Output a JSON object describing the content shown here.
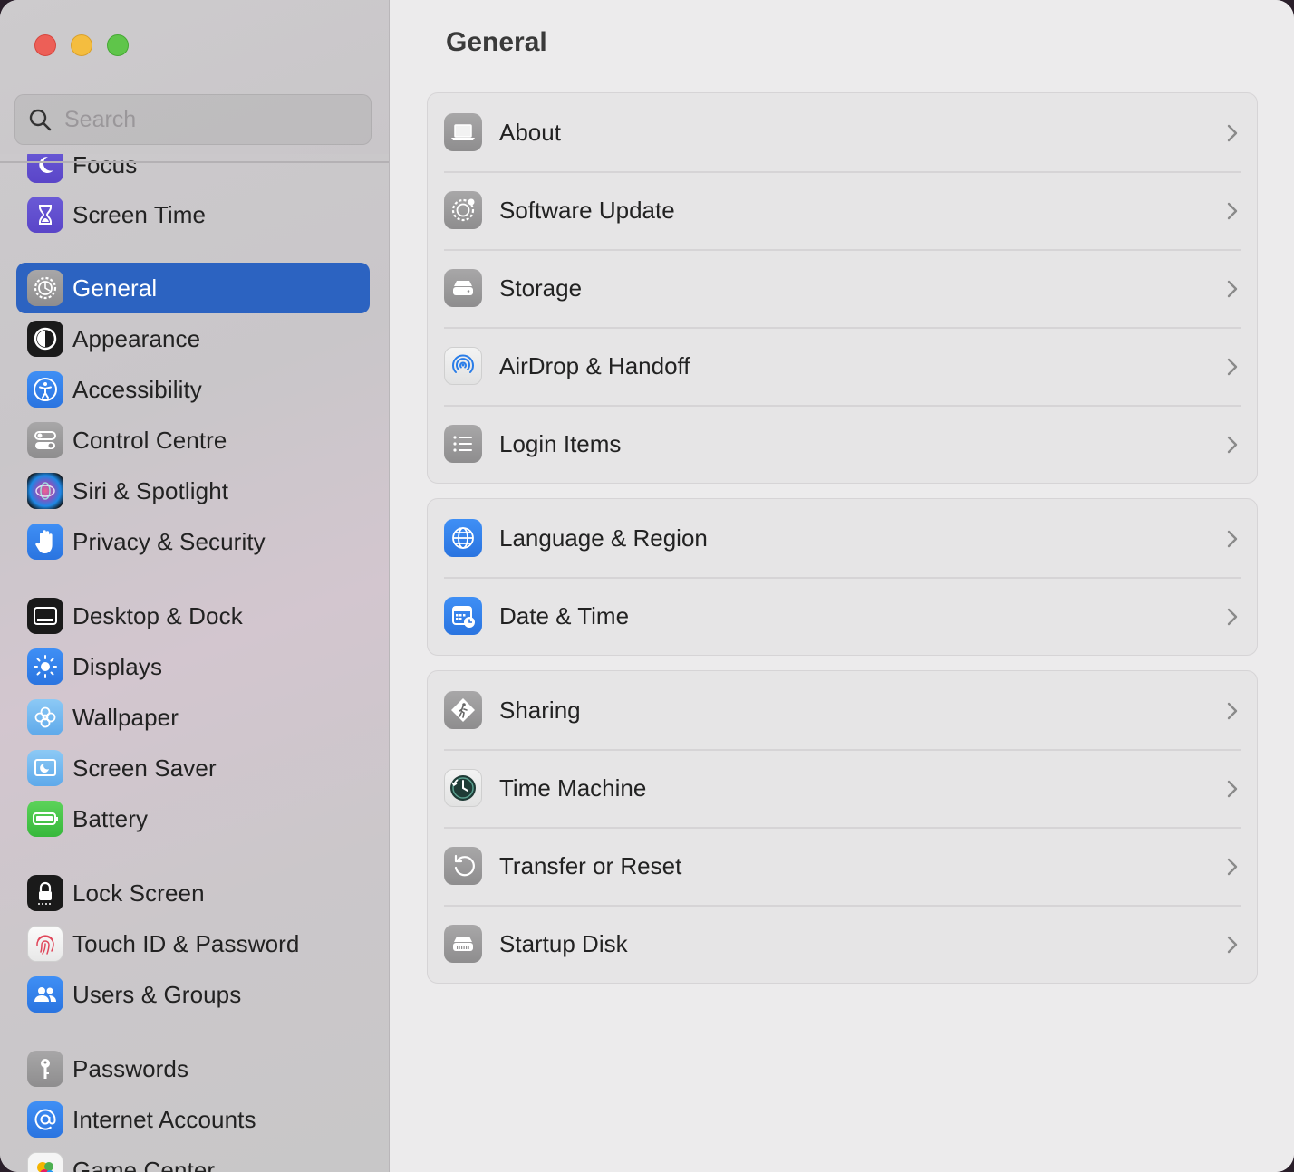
{
  "window": {
    "title": "General"
  },
  "search": {
    "placeholder": "Search"
  },
  "sidebar": {
    "items": [
      {
        "label": "Focus",
        "icon": "moon-icon"
      },
      {
        "label": "Screen Time",
        "icon": "hourglass-icon"
      },
      {
        "label": "General",
        "icon": "gear-icon",
        "selected": true
      },
      {
        "label": "Appearance",
        "icon": "appearance-icon"
      },
      {
        "label": "Accessibility",
        "icon": "accessibility-icon"
      },
      {
        "label": "Control Centre",
        "icon": "toggles-icon"
      },
      {
        "label": "Siri & Spotlight",
        "icon": "siri-icon"
      },
      {
        "label": "Privacy & Security",
        "icon": "hand-icon"
      },
      {
        "label": "Desktop & Dock",
        "icon": "dock-icon"
      },
      {
        "label": "Displays",
        "icon": "sun-icon"
      },
      {
        "label": "Wallpaper",
        "icon": "flower-icon"
      },
      {
        "label": "Screen Saver",
        "icon": "screensaver-icon"
      },
      {
        "label": "Battery",
        "icon": "battery-icon"
      },
      {
        "label": "Lock Screen",
        "icon": "lock-icon"
      },
      {
        "label": "Touch ID & Password",
        "icon": "fingerprint-icon"
      },
      {
        "label": "Users & Groups",
        "icon": "users-icon"
      },
      {
        "label": "Passwords",
        "icon": "key-icon"
      },
      {
        "label": "Internet Accounts",
        "icon": "at-icon"
      },
      {
        "label": "Game Center",
        "icon": "game-center-icon"
      }
    ]
  },
  "main": {
    "title": "General",
    "groups": [
      {
        "rows": [
          {
            "label": "About",
            "icon": "laptop-icon"
          },
          {
            "label": "Software Update",
            "icon": "software-update-icon"
          },
          {
            "label": "Storage",
            "icon": "storage-icon"
          },
          {
            "label": "AirDrop & Handoff",
            "icon": "airdrop-icon"
          },
          {
            "label": "Login Items",
            "icon": "list-icon"
          }
        ]
      },
      {
        "rows": [
          {
            "label": "Language & Region",
            "icon": "globe-icon"
          },
          {
            "label": "Date & Time",
            "icon": "calendar-clock-icon"
          }
        ]
      },
      {
        "rows": [
          {
            "label": "Sharing",
            "icon": "sharing-icon"
          },
          {
            "label": "Time Machine",
            "icon": "time-machine-icon"
          },
          {
            "label": "Transfer or Reset",
            "icon": "reset-icon"
          },
          {
            "label": "Startup Disk",
            "icon": "disk-icon"
          }
        ]
      }
    ]
  },
  "colors": {
    "accent": "#2c63c1",
    "close": "#ed5f57",
    "minimize": "#f4bd3f",
    "maximize": "#5fc54a"
  }
}
